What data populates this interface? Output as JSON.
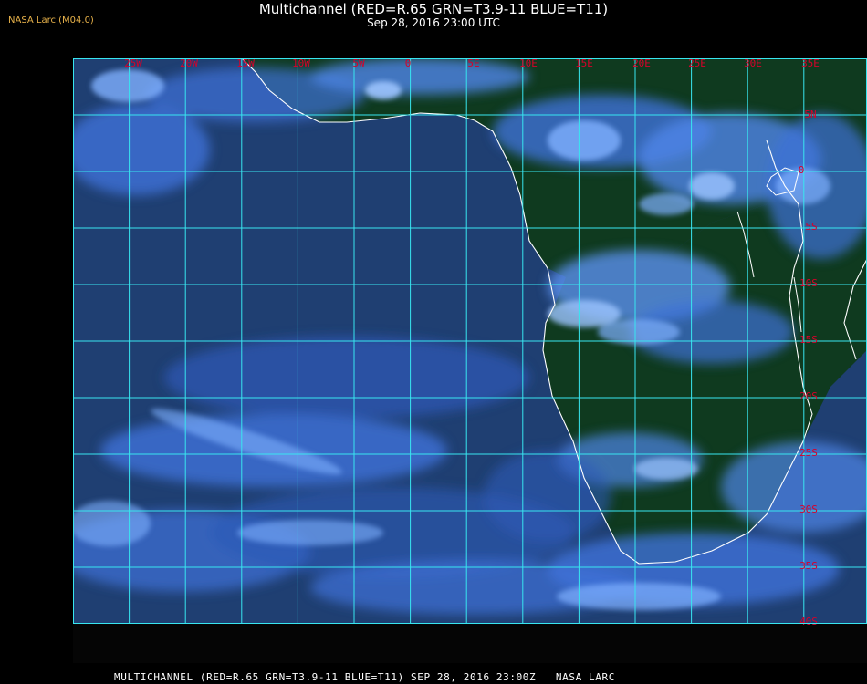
{
  "header": {
    "credit": "NASA Larc (M04.0)",
    "title": "Multichannel (RED=R.65 GRN=T3.9-11 BLUE=T11)",
    "subtitle": "Sep 28, 2016 23:00 UTC"
  },
  "footer": {
    "caption": "MULTICHANNEL (RED=R.65 GRN=T3.9-11 BLUE=T11) SEP 28, 2016 23:00Z   NASA LARC"
  },
  "map": {
    "longitude_labels": [
      "25W",
      "20W",
      "15W",
      "10W",
      "5W",
      "0",
      "5E",
      "10E",
      "15E",
      "20E",
      "25E",
      "30E",
      "35E"
    ],
    "latitude_labels": [
      "5N",
      "0",
      "5S",
      "10S",
      "15S",
      "20S",
      "25S",
      "30S",
      "35S",
      "40S"
    ],
    "colors": {
      "ocean": "#1f3f72",
      "land": "#0f3a1f",
      "cloud_bright": "#7fb0ff",
      "cloud_mid": "#3f72d8",
      "grid": "#38e6f0",
      "label": "#d8002a",
      "coast": "#ffffff"
    }
  }
}
